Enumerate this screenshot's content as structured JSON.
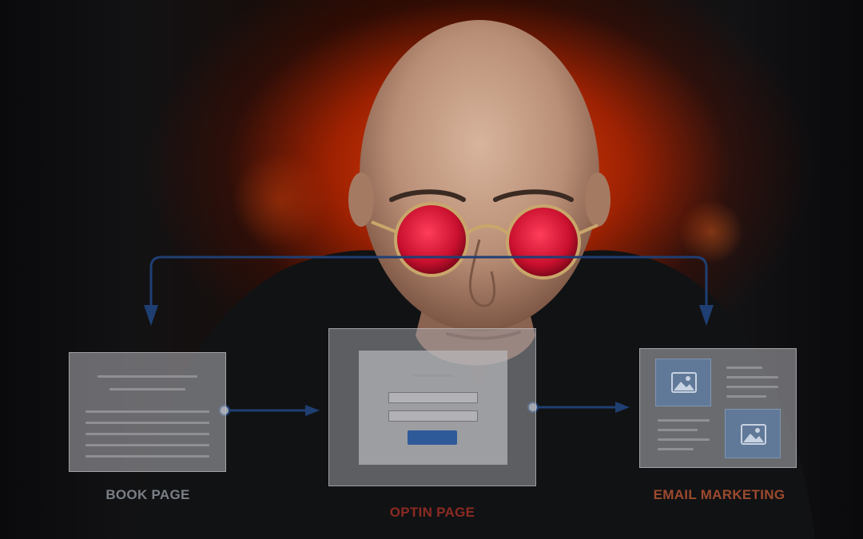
{
  "diagram": {
    "nodes": [
      {
        "id": "book",
        "label": "BOOK PAGE"
      },
      {
        "id": "optin",
        "label": "OPTIN PAGE"
      },
      {
        "id": "email",
        "label": "EMAIL MARKETING"
      }
    ],
    "edges": [
      {
        "from": "book",
        "to": "optin"
      },
      {
        "from": "optin",
        "to": "email"
      },
      {
        "from": "email",
        "to": "book",
        "route": "top-loop"
      },
      {
        "from": "book",
        "to": "email",
        "route": "top-loop"
      }
    ]
  },
  "colors": {
    "book_label": "#7a7f86",
    "optin_label": "#8b2a22",
    "email_label": "#9c4a2e",
    "arrow": "#1f3f73",
    "button": "#2f5a9a"
  },
  "icons": [
    "image-icon",
    "image-icon"
  ]
}
